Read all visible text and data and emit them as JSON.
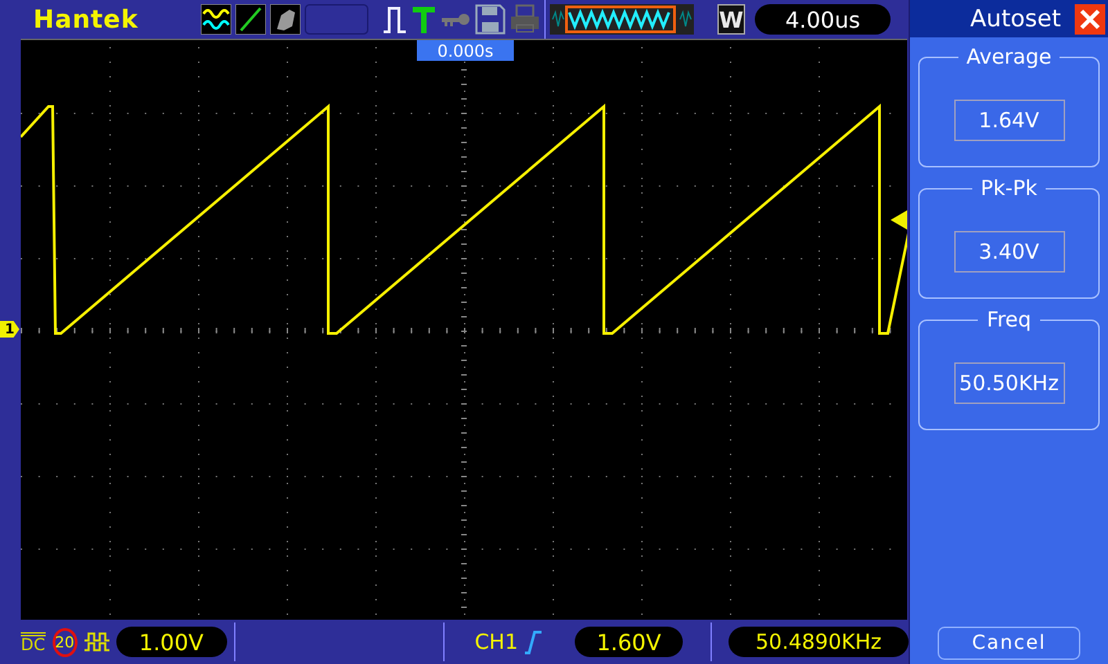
{
  "brand": "Hantek",
  "top_bar": {
    "zoom_button": "W",
    "timebase": "4.00us"
  },
  "screen": {
    "trigger_position": "0.000s",
    "channel_marker": "1"
  },
  "bottom_bar": {
    "coupling": "DC",
    "bandwidth_limit": "20",
    "volts_per_div": "1.00V",
    "trigger_source": "CH1",
    "trigger_level": "1.60V",
    "frequency": "50.4890KHz"
  },
  "panel": {
    "title": "Autoset",
    "measurements": [
      {
        "label": "Average",
        "value": "1.64V"
      },
      {
        "label": "Pk-Pk",
        "value": "3.40V"
      },
      {
        "label": "Freq",
        "value": "50.50KHz"
      }
    ],
    "cancel": "Cancel"
  }
}
